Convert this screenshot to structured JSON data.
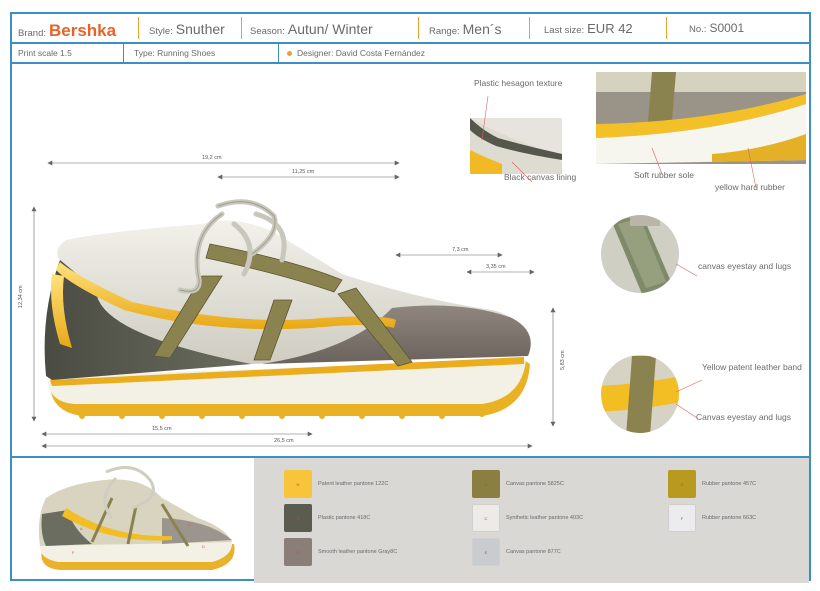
{
  "header": {
    "brand_label": "Brand:",
    "brand_value": "Bershka",
    "style_label": "Style:",
    "style_value": "Snuther",
    "season_label": "Season:",
    "season_value": "Autun/ Winter",
    "range_label": "Range:",
    "range_value": "Men´s",
    "last_size_label": "Last size:",
    "last_size_value": "EUR 42",
    "no_label": "No.:",
    "no_value": "S0001"
  },
  "subheader": {
    "print_scale": "Print scale 1.5",
    "type": "Type: Running Shoes",
    "designer": "Designer: David Costa Fernández"
  },
  "dimensions": {
    "total_top": "19,2 cm",
    "upper_top": "11,25 cm",
    "toe_a": "7,3 cm",
    "toe_b": "3,35 cm",
    "height_left": "12,34 cm",
    "height_right": "5,83 cm",
    "bottom_a": "15,5 cm",
    "bottom_b": "26,5 cm"
  },
  "callouts": {
    "hexagon": "Plastic hesagon texture",
    "lining": "Black canvas lining",
    "soft_sole": "Soft rubber sole",
    "hard_rubber": "yellow hard rubber",
    "eyestay_1": "canvas eyestay and lugs",
    "patent_band": "Yellow patent leather band",
    "eyestay_2": "Canvas eyestay and lugs"
  },
  "colors": {
    "accent_border": "#3a8fc4",
    "separator": "#f0a030",
    "brand": "#e8622a"
  },
  "swatches": [
    {
      "code": "H",
      "name": "Patent leather pantone 122C",
      "color": "#f7c43a"
    },
    {
      "code": "B",
      "name": "Plastic pantone 418C",
      "color": "#5a5c50"
    },
    {
      "code": "G",
      "name": "Smooth leather pantone Gray8C",
      "color": "#8a7f78"
    },
    {
      "code": "D",
      "name": "Canvas pantone 5825C",
      "color": "#8a7f40"
    },
    {
      "code": "C",
      "name": "Synthetic leather pantone 403C",
      "color": "#ecebe8"
    },
    {
      "code": "E",
      "name": "Canvas pantone 877C",
      "color": "#c9ccce"
    },
    {
      "code": "G",
      "name": "Rubber pantone 457C",
      "color": "#b89a20"
    },
    {
      "code": "F",
      "name": "Rubber pantone 663C",
      "color": "#ecebee"
    }
  ]
}
